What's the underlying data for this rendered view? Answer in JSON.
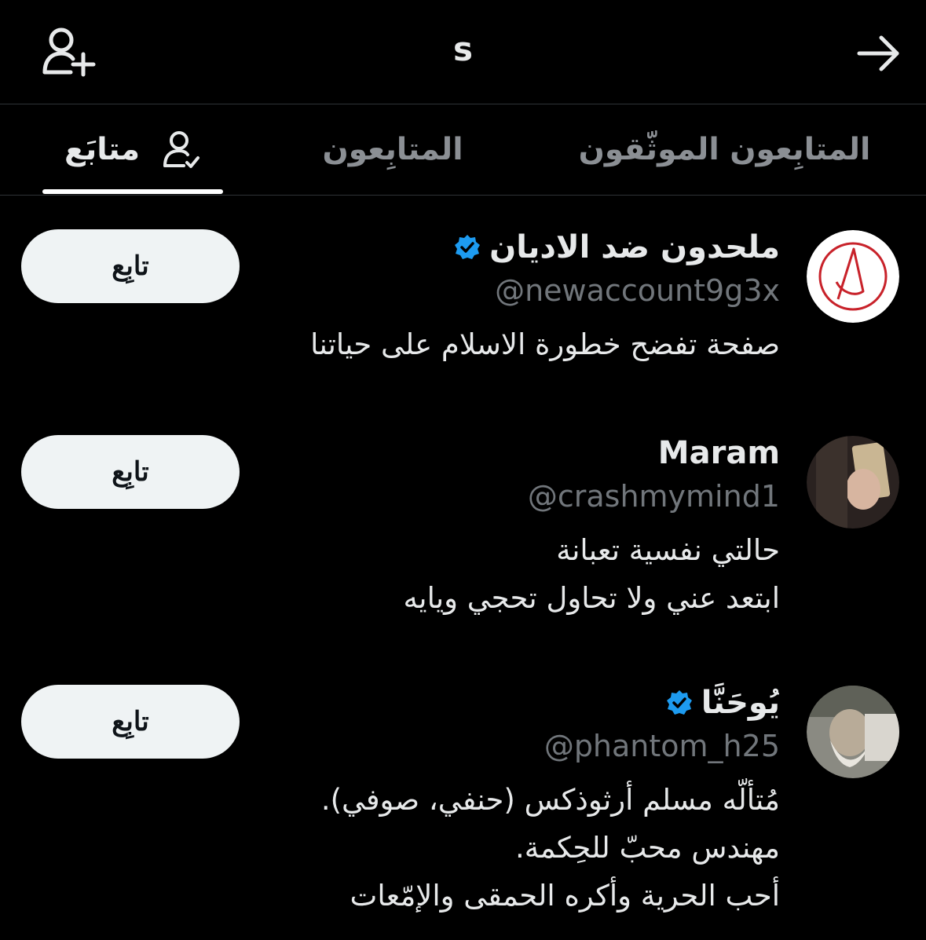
{
  "header": {
    "title": "s"
  },
  "tabs": {
    "verified_label": "المتابِعون الموثّقون",
    "followers_label": "المتابِعون",
    "following_label": "متابَع"
  },
  "users": [
    {
      "name": "ملحدون ضد الاديان",
      "handle": "@newaccount9g3x",
      "bio": [
        "صفحة تفضح خطورة الاسلام على حياتنا"
      ],
      "verified": true,
      "follow_label": "تابِع"
    },
    {
      "name": "Maram",
      "handle": "@crashmymind1",
      "bio": [
        "حالتي نفسية تعبانة",
        "ابتعد عني ولا تحاول تحجي ويايه"
      ],
      "verified": false,
      "follow_label": "تابِع"
    },
    {
      "name": "يُوحَنَّا",
      "handle": "@phantom_h25",
      "bio": [
        "مُتألّه مسلم أرثوذكس (حنفي، صوفي).",
        "مهندس محبّ للحِكمة.",
        "أحب الحرية وأكره الحمقى والإمّعات"
      ],
      "verified": true,
      "follow_label": "تابِع"
    }
  ],
  "colors": {
    "background": "#000000",
    "verified_badge": "#1d9bf0",
    "button_bg": "#eff3f4",
    "muted_text": "#71767b"
  }
}
